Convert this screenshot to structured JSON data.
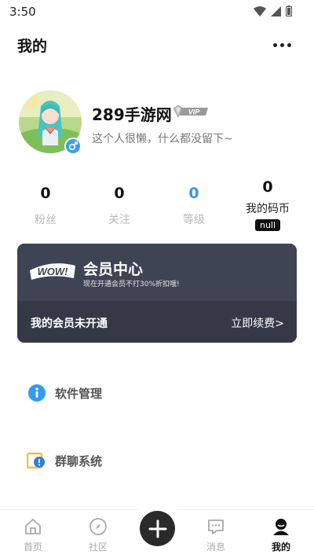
{
  "status_bar": {
    "time": "3:50"
  },
  "header": {
    "title": "我的"
  },
  "profile": {
    "username": "289手游网",
    "vip_badge": "VIP",
    "bio": "这个人很懒，什么都没留下~"
  },
  "stats": [
    {
      "value": "0",
      "label": "粉丝"
    },
    {
      "value": "0",
      "label": "关注"
    },
    {
      "value": "0",
      "label": "等级"
    },
    {
      "value": "0",
      "label": "我的码币",
      "badge": "null"
    }
  ],
  "member_card": {
    "logo_text": "WOW!",
    "title": "会员中心",
    "subtitle": "现在开通会员不打30%折扣哦!",
    "status": "我的会员未开通",
    "action": "立即续费>"
  },
  "menu": [
    {
      "label": "软件管理",
      "icon": "info-icon"
    },
    {
      "label": "群聊系统",
      "icon": "group-chat-icon"
    }
  ],
  "bottom_nav": [
    {
      "label": "首页",
      "icon": "home-icon"
    },
    {
      "label": "社区",
      "icon": "compass-icon"
    },
    {
      "label": "消息",
      "icon": "message-icon"
    },
    {
      "label": "我的",
      "icon": "profile-icon",
      "active": true
    }
  ],
  "colors": {
    "accent_blue": "#3a95f0",
    "card_dark": "#3c4150",
    "fab": "#2a2a2a"
  }
}
